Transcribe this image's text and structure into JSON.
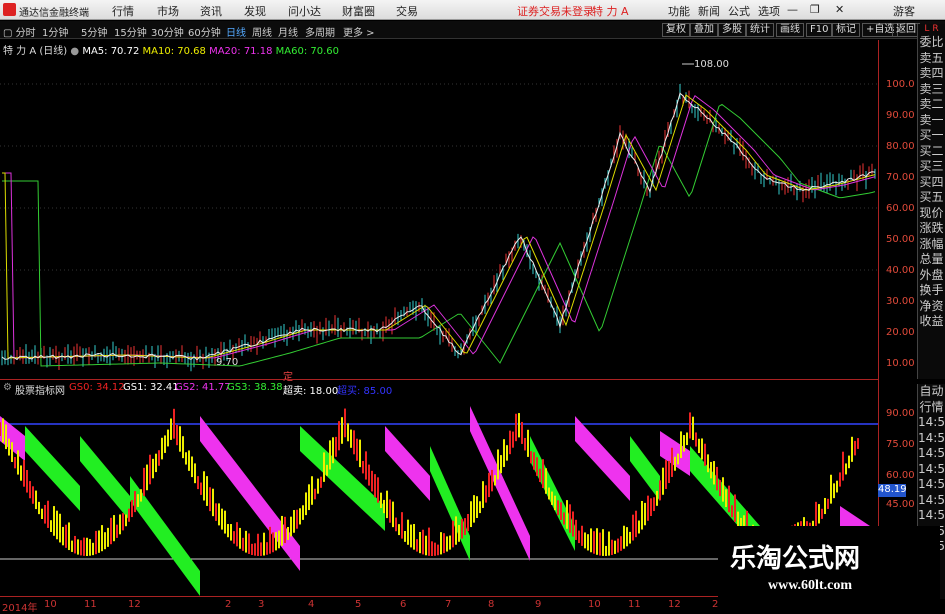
{
  "titlebar": {
    "app": "通达信金融终端",
    "menu": [
      "行情",
      "市场",
      "资讯",
      "发现",
      "问小达",
      "财富圈",
      "交易"
    ],
    "notice": "证券交易未登录",
    "stock": "特 力 A",
    "right": [
      "功能",
      "新闻",
      "公式",
      "选项"
    ],
    "guest": "游客"
  },
  "period": {
    "items": [
      "分时",
      "1分钟",
      "5分钟",
      "15分钟",
      "30分钟",
      "60分钟",
      "日线",
      "周线",
      "月线",
      "多周期",
      "更多 >"
    ],
    "active": "日线",
    "right": [
      "复权",
      "叠加",
      "多股",
      "统计",
      "画线",
      "F10",
      "标记",
      "+自选",
      "返回"
    ]
  },
  "ma": {
    "name": "特 力 A",
    "cycle": "(日线)",
    "ma5": "MA5: 70.72",
    "ma10": "MA10: 70.68",
    "ma20": "MA20: 71.18",
    "ma60": "MA60: 70.60"
  },
  "price_axis": [
    "100.0",
    "90.00",
    "80.00",
    "70.00",
    "60.00",
    "50.00",
    "40.00",
    "30.00",
    "20.00",
    "10.00"
  ],
  "high_label": "108.00",
  "low_label": "9.70",
  "marker": "定",
  "indicator": {
    "name": "股票指标网",
    "gs0": "GS0: 34.12",
    "gs1": "GS1: 32.41",
    "gs2": "GS2: 41.77",
    "gs3": "GS3: 38.38",
    "cs": "超卖: 18.00",
    "cb": "超买: 85.00",
    "value": "48.19"
  },
  "ind_axis": [
    "90.00",
    "75.00",
    "60.00",
    "45.00"
  ],
  "sidebar_top": [
    "L",
    "R"
  ],
  "sidebar": [
    "委比",
    "卖五",
    "卖四",
    "卖三",
    "卖二",
    "卖一",
    "买一",
    "买二",
    "买三",
    "买四",
    "买五",
    "现价",
    "涨跌",
    "涨幅",
    "总量",
    "外盘",
    "换手",
    "净资",
    "收益"
  ],
  "sidebar2": [
    "自动",
    "行情",
    "14:5",
    "14:5",
    "14:5",
    "14:5",
    "14:5",
    "14:5",
    "14:5",
    "14:5",
    "14:5"
  ],
  "dates": [
    "2014年",
    "10",
    "11",
    "12",
    "2",
    "3",
    "4",
    "5",
    "6",
    "7",
    "8",
    "9",
    "10",
    "11",
    "12",
    "2"
  ],
  "watermark": {
    "title": "乐淘公式网",
    "url": "www.60lt.com"
  }
}
